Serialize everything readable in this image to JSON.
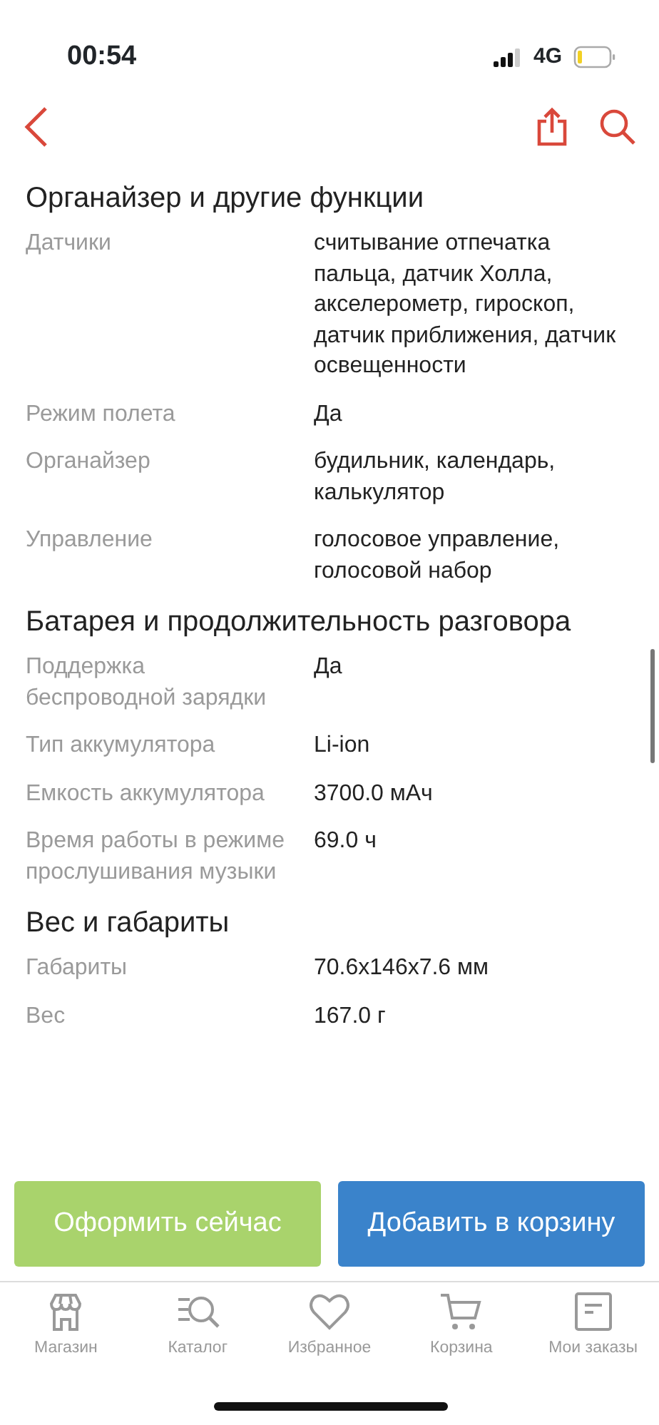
{
  "status_bar": {
    "time": "00:54",
    "network": "4G"
  },
  "sections": [
    {
      "title": "Органайзер и другие функции",
      "rows": [
        {
          "label": "Датчики",
          "value": "считывание отпечатка пальца, датчик Холла, акселерометр, гироскоп, датчик приближения, датчик освещенности"
        },
        {
          "label": "Режим полета",
          "value": "Да"
        },
        {
          "label": "Органайзер",
          "value": "будильник, календарь, калькулятор"
        },
        {
          "label": "Управление",
          "value": "голосовое управление, голосовой набор"
        }
      ]
    },
    {
      "title": "Батарея и продолжительность разговора",
      "rows": [
        {
          "label": "Поддержка беспроводной зарядки",
          "value": "Да"
        },
        {
          "label": "Тип аккумулятора",
          "value": "Li-ion"
        },
        {
          "label": "Емкость аккумулятора",
          "value": "3700.0 мАч"
        },
        {
          "label": "Время работы в режиме прослушивания музыки",
          "value": "69.0 ч"
        }
      ]
    },
    {
      "title": "Вес и габариты",
      "rows": [
        {
          "label": "Габариты",
          "value": "70.6x146x7.6 мм"
        },
        {
          "label": "Вес",
          "value": "167.0 г"
        }
      ]
    }
  ],
  "actions": [
    {
      "label": "Оформить сейчас",
      "kind": "buy"
    },
    {
      "label": "Добавить в корзину",
      "kind": "cart"
    }
  ],
  "tab_bar": [
    {
      "label": "Магазин",
      "kind": "shop"
    },
    {
      "label": "Каталог",
      "kind": "catalog"
    },
    {
      "label": "Избранное",
      "kind": "favorites"
    },
    {
      "label": "Корзина",
      "kind": "cart"
    },
    {
      "label": "Мои заказы",
      "kind": "orders"
    }
  ]
}
